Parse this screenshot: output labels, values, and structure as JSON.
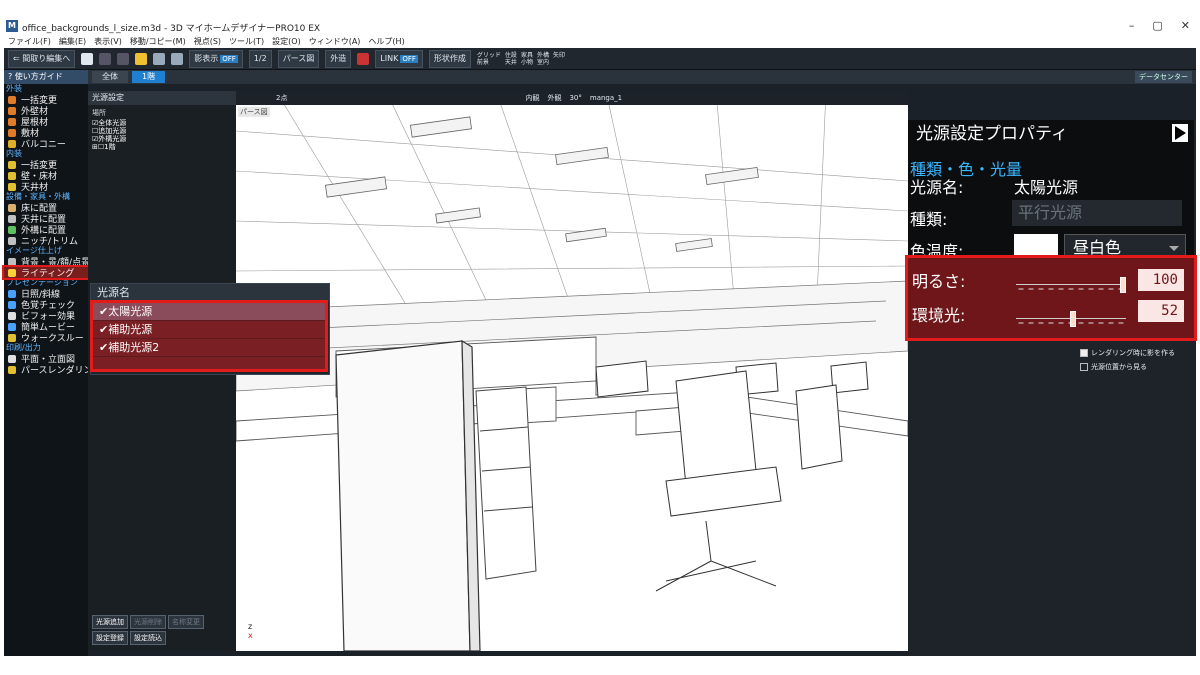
{
  "window": {
    "title": "office_backgrounds_l_size.m3d - 3D マイホームデザイナーPRO10 EX",
    "controls": [
      "–",
      "▢",
      "✕"
    ]
  },
  "menu": [
    "ファイル(F)",
    "編集(E)",
    "表示(V)",
    "移動/コピー(M)",
    "視点(S)",
    "ツール(T)",
    "設定(O)",
    "ウィンドウ(A)",
    "ヘルプ(H)"
  ],
  "toolbar": {
    "back_label": "間取り編集へ",
    "shadow_label": "影表示",
    "shadow_state": "OFF",
    "scale_label": "1/2",
    "pers_label": "パース図",
    "exterior_label": "外造",
    "link_label": "LINK",
    "link_state": "OFF",
    "shape_label": "形状作成",
    "checks": [
      "グリッド",
      "住設",
      "家具",
      "外構",
      "矢印",
      "前景",
      "天井",
      "小物",
      "室内"
    ]
  },
  "tabs": {
    "guide": "使い方ガイド",
    "all": "全体",
    "floor1": "1階",
    "datacenter": "データセンター"
  },
  "sidebar": [
    {
      "type": "sec",
      "label": "外装"
    },
    {
      "type": "item",
      "label": "一括変更",
      "color": "#e07b28"
    },
    {
      "type": "item",
      "label": "外壁材",
      "color": "#e07b28"
    },
    {
      "type": "item",
      "label": "屋根材",
      "color": "#e07b28"
    },
    {
      "type": "item",
      "label": "敷材",
      "color": "#e07b28"
    },
    {
      "type": "item",
      "label": "バルコニー",
      "color": "#e0b028"
    },
    {
      "type": "sec",
      "label": "内装"
    },
    {
      "type": "item",
      "label": "一括変更",
      "color": "#e0c030"
    },
    {
      "type": "item",
      "label": "壁・床材",
      "color": "#e0c030"
    },
    {
      "type": "item",
      "label": "天井材",
      "color": "#e0c030"
    },
    {
      "type": "sec",
      "label": "設備・家具・外構"
    },
    {
      "type": "item",
      "label": "床に配置",
      "color": "#d9b070"
    },
    {
      "type": "item",
      "label": "天井に配置",
      "color": "#c0c0c0"
    },
    {
      "type": "item",
      "label": "外構に配置",
      "color": "#60c060"
    },
    {
      "type": "item",
      "label": "ニッチ/トリム",
      "color": "#c0c0c0"
    },
    {
      "type": "sec",
      "label": "イメージ仕上げ"
    },
    {
      "type": "item",
      "label": "背景・景/額/点景",
      "color": "#c0c0c0"
    },
    {
      "type": "item",
      "label": "ライティング",
      "color": "#ffd23a",
      "selected": true
    },
    {
      "type": "sec",
      "label": "プレゼンテーション"
    },
    {
      "type": "item",
      "label": "日照/斜線",
      "color": "#4aa0ff"
    },
    {
      "type": "item",
      "label": "色覚チェック",
      "color": "#4aa0ff"
    },
    {
      "type": "item",
      "label": "ビフォー効果",
      "color": "#e0e0e0"
    },
    {
      "type": "item",
      "label": "簡単ムービー",
      "color": "#4aa0ff"
    },
    {
      "type": "item",
      "label": "ウォークスルー",
      "color": "#e0c030"
    },
    {
      "type": "sec",
      "label": "印刷/出力"
    },
    {
      "type": "item",
      "label": "平面・立面図",
      "color": "#e0e0e0"
    },
    {
      "type": "item",
      "label": "パースレンダリング",
      "color": "#e0c030"
    }
  ],
  "panel": {
    "title": "光源設定",
    "place_label": "場所",
    "tree": [
      "☑全体光源",
      "☐追加光源",
      "☑外構光源",
      "⊞☐1階"
    ],
    "buttons": [
      "光源追加",
      "光源削除",
      "名称変更",
      "設定登録",
      "設定読込"
    ]
  },
  "popup": {
    "title": "光源名",
    "items": [
      "✔太陽光源",
      "✔補助光源",
      "✔補助光源2"
    ]
  },
  "viewport": {
    "label": "パース図",
    "toolbar_items": [
      "2点",
      "内観",
      "外観",
      "30°",
      "manga_1"
    ],
    "axis_z": "z",
    "axis_x": "x"
  },
  "props": {
    "title": "光源設定プロパティ",
    "section": "種類・色・光量",
    "name_label": "光源名:",
    "name_value": "太陽光源",
    "type_label": "種類:",
    "type_value": "平行光源",
    "temp_label": "色温度:",
    "temp_value": "昼白色",
    "brightness_label": "明るさ:",
    "brightness_value": "100",
    "brightness_level": 1.0,
    "ambient_label": "環境光:",
    "ambient_value": "52",
    "ambient_level": 0.52,
    "opt_render": "レンダリング時に影を作る",
    "opt_view": "光源位置から見る"
  }
}
